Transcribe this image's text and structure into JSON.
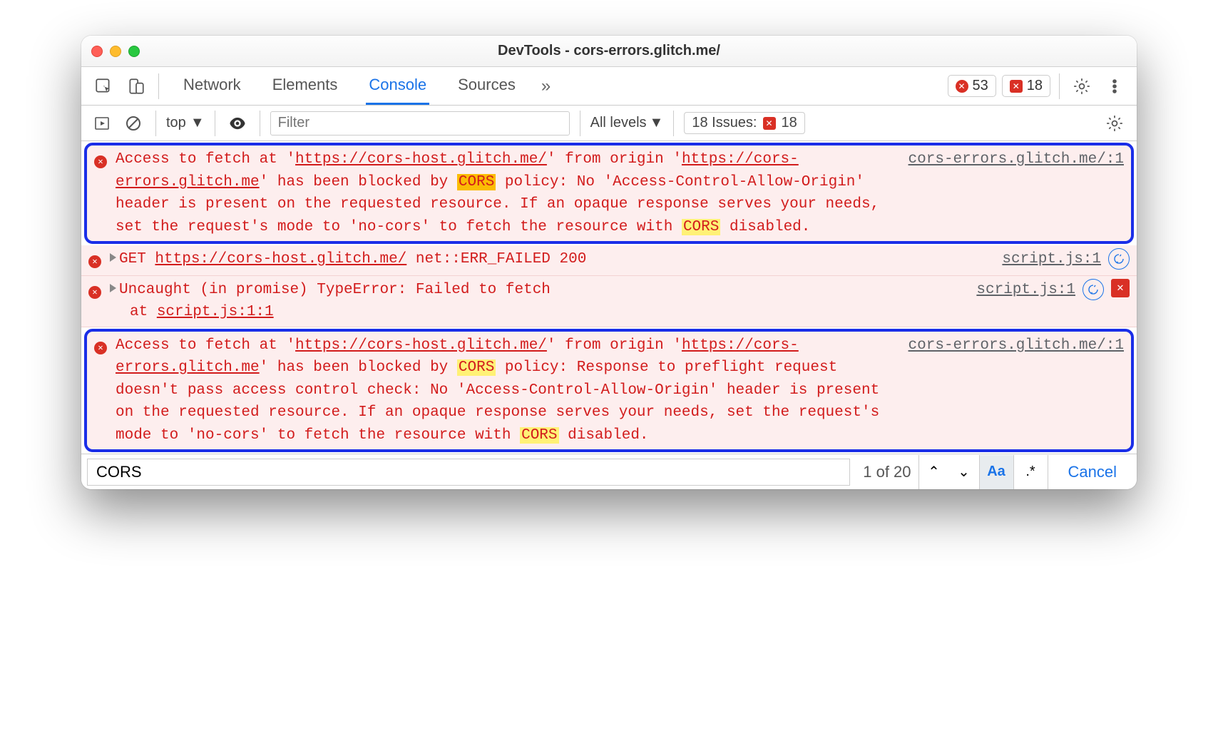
{
  "window": {
    "title": "DevTools - cors-errors.glitch.me/"
  },
  "tabs": {
    "items": [
      "Network",
      "Elements",
      "Console",
      "Sources"
    ],
    "active": "Console"
  },
  "counters": {
    "errors": "53",
    "issues": "18"
  },
  "toolbar": {
    "context": "top",
    "filter_placeholder": "Filter",
    "levels": "All levels",
    "issues_label": "18 Issues:",
    "issues_count": "18"
  },
  "messages": [
    {
      "kind": "error",
      "highlighted": true,
      "source": "cors-errors.glitch.me/:1",
      "text_parts": [
        {
          "t": "Access to fetch at '"
        },
        {
          "t": "https://cors-host.glitch.me/",
          "u": true
        },
        {
          "t": "' from origin '"
        },
        {
          "t": "https://cors-errors.glitch.me",
          "u": true
        },
        {
          "t": "' has been blocked by "
        },
        {
          "t": "CORS",
          "hl": "o"
        },
        {
          "t": " policy: No 'Access-Control-Allow-Origin' header is present on the requested resource. If an opaque response serves your needs, set the request's mode to 'no-cors' to fetch the resource with "
        },
        {
          "t": "CORS",
          "hl": "y"
        },
        {
          "t": " disabled."
        }
      ]
    },
    {
      "kind": "error",
      "expandable": true,
      "source": "script.js:1",
      "refresh_icon": true,
      "text_parts": [
        {
          "t": "GET "
        },
        {
          "t": "https://cors-host.glitch.me/",
          "u": true
        },
        {
          "t": " net::ERR_FAILED 200"
        }
      ]
    },
    {
      "kind": "error",
      "expandable": true,
      "source": "script.js:1",
      "refresh_icon": true,
      "close_icon": true,
      "text_parts": [
        {
          "t": "Uncaught (in promise) TypeError: Failed to fetch"
        }
      ],
      "stack": [
        {
          "prefix": "    at ",
          "link": "script.js:1:1"
        }
      ]
    },
    {
      "kind": "error",
      "highlighted": true,
      "source": "cors-errors.glitch.me/:1",
      "text_parts": [
        {
          "t": "Access to fetch at '"
        },
        {
          "t": "https://cors-host.glitch.me/",
          "u": true
        },
        {
          "t": "' from origin '"
        },
        {
          "t": "https://cors-errors.glitch.me",
          "u": true
        },
        {
          "t": "' has been blocked by "
        },
        {
          "t": "CORS",
          "hl": "y"
        },
        {
          "t": " policy: Response to preflight request doesn't pass access control check: No 'Access-Control-Allow-Origin' header is present on the requested resource. If an opaque response serves your needs, set the request's mode to 'no-cors' to fetch the resource with "
        },
        {
          "t": "CORS",
          "hl": "y"
        },
        {
          "t": " disabled."
        }
      ]
    }
  ],
  "find": {
    "query": "CORS",
    "count": "1 of 20",
    "match_case_label": "Aa",
    "regex_label": ".*",
    "cancel": "Cancel"
  }
}
